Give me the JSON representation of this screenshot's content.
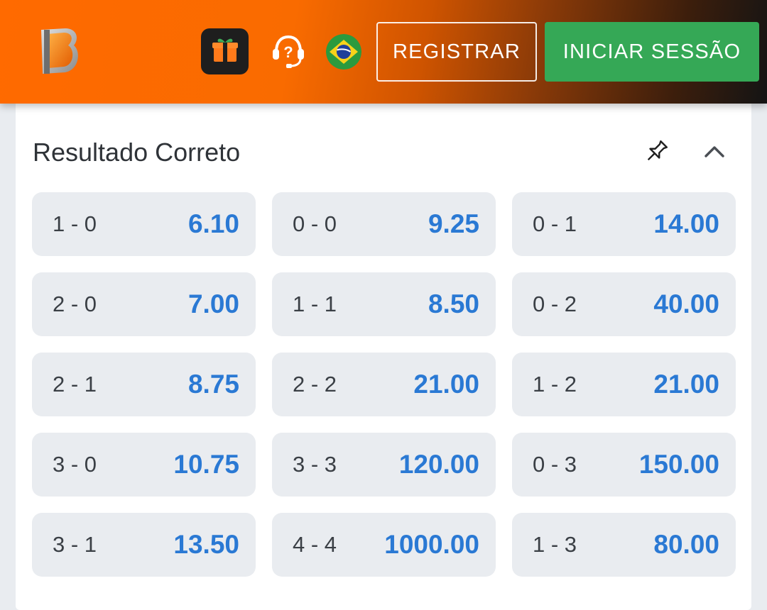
{
  "header": {
    "register_label": "REGISTRAR",
    "login_label": "INICIAR SESSÃO",
    "icons": {
      "logo": "brand-logo-icon",
      "gift": "gift-icon",
      "support": "headset-help-icon",
      "language": "brazil-flag-icon"
    },
    "colors": {
      "brand_orange": "#ff6a00",
      "login_green": "#35a856"
    }
  },
  "market": {
    "title": "Resultado Correto",
    "icons": {
      "pin": "pin-icon",
      "collapse": "chevron-up-icon"
    },
    "odds_color": "#2a79d4",
    "odds": [
      {
        "score": "1 - 0",
        "price": "6.10"
      },
      {
        "score": "0 - 0",
        "price": "9.25"
      },
      {
        "score": "0 - 1",
        "price": "14.00"
      },
      {
        "score": "2 - 0",
        "price": "7.00"
      },
      {
        "score": "1 - 1",
        "price": "8.50"
      },
      {
        "score": "0 - 2",
        "price": "40.00"
      },
      {
        "score": "2 - 1",
        "price": "8.75"
      },
      {
        "score": "2 - 2",
        "price": "21.00"
      },
      {
        "score": "1 - 2",
        "price": "21.00"
      },
      {
        "score": "3 - 0",
        "price": "10.75"
      },
      {
        "score": "3 - 3",
        "price": "120.00"
      },
      {
        "score": "0 - 3",
        "price": "150.00"
      },
      {
        "score": "3 - 1",
        "price": "13.50"
      },
      {
        "score": "4 - 4",
        "price": "1000.00"
      },
      {
        "score": "1 - 3",
        "price": "80.00"
      }
    ]
  }
}
